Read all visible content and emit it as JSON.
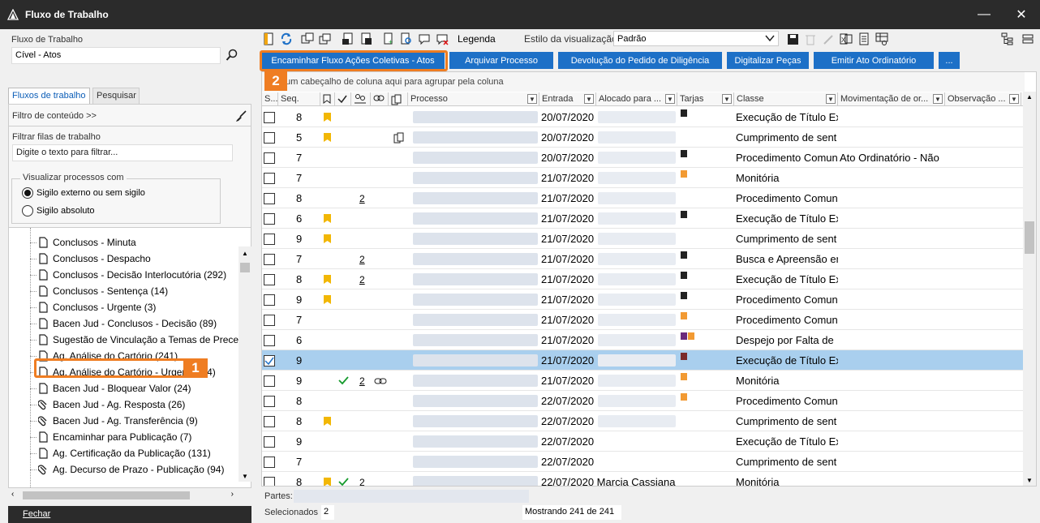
{
  "window": {
    "title": "Fluxo de Trabalho",
    "minimize": "—",
    "close": "✕"
  },
  "left": {
    "workflow_label": "Fluxo de Trabalho",
    "workflow_value": "Cível - Atos",
    "tabs": [
      "Fluxos de trabalho",
      "Pesquisar"
    ],
    "content_filter": "Filtro de conteúdo >>",
    "filter_label": "Filtrar filas de trabalho",
    "filter_placeholder": "Digite o texto para filtrar...",
    "visualize_label": "Visualizar processos com",
    "radio_options": [
      "Sigilo externo ou sem sigilo",
      "Sigilo absoluto"
    ],
    "tree_items": [
      "Conclusos - Minuta",
      "Conclusos - Despacho",
      "Conclusos - Decisão Interlocutória (292)",
      "Conclusos - Sentença (14)",
      "Conclusos - Urgente (3)",
      "Bacen Jud - Conclusos - Decisão (89)",
      "Sugestão de Vinculação a Temas de Preced",
      "Ag. Análise do Cartório (241)",
      "Ag. Análise do Cartório - Urgente (64)",
      "Bacen Jud - Bloquear Valor (24)",
      "Bacen Jud - Ag. Resposta (26)",
      "Bacen Jud - Ag. Transferência (9)",
      "Encaminhar para Publicação (7)",
      "Ag. Certificação da Publicação (131)",
      "Ag. Decurso de Prazo - Publicação (94)"
    ],
    "close_button": "Fechar",
    "callout1": "1"
  },
  "toolbar": {
    "legend": "Legenda",
    "view_style_label": "Estilo da visualização",
    "view_style_value": "Padrão",
    "actions": [
      "Encaminhar Fluxo Ações Coletivas - Atos",
      "Arquivar Processo",
      "Devolução do Pedido de Diligência",
      "Digitalizar Peças",
      "Emitir Ato Ordinatório",
      "..."
    ],
    "callout2": "2",
    "accent": "#1d70c7",
    "callout_color": "#ef7d22"
  },
  "grid": {
    "group_hint": "e um cabeçalho de coluna aqui para agrupar pela coluna",
    "columns": [
      "S...",
      "Seq.",
      "",
      "",
      "",
      "",
      "",
      "Processo",
      "Entrada",
      "Alocado para ...",
      "Tarjas",
      "Classe",
      "Movimentação de or...",
      "Observação ..."
    ],
    "rows": [
      {
        "seq": "8",
        "flag": true,
        "check": false,
        "count": "",
        "link": false,
        "doc": false,
        "entrada": "20/07/2020",
        "tarjas": [
          "#222"
        ],
        "classe": "Execução de Título Ex",
        "mov": "",
        "checked": false
      },
      {
        "seq": "5",
        "flag": true,
        "check": false,
        "count": "",
        "link": false,
        "doc": true,
        "entrada": "20/07/2020",
        "tarjas": [],
        "classe": "Cumprimento de sent",
        "mov": "",
        "checked": false
      },
      {
        "seq": "7",
        "flag": false,
        "check": false,
        "count": "",
        "link": false,
        "doc": false,
        "entrada": "20/07/2020",
        "tarjas": [
          "#222"
        ],
        "classe": "Procedimento Comun",
        "mov": "Ato Ordinatório - Não",
        "checked": false
      },
      {
        "seq": "7",
        "flag": false,
        "check": false,
        "count": "",
        "link": false,
        "doc": false,
        "entrada": "21/07/2020",
        "tarjas": [
          "#f29a33"
        ],
        "classe": "Monitória",
        "mov": "",
        "checked": false
      },
      {
        "seq": "8",
        "flag": false,
        "check": false,
        "count": "2",
        "link": false,
        "doc": false,
        "entrada": "21/07/2020",
        "tarjas": [],
        "classe": "Procedimento Comun",
        "mov": "",
        "checked": false
      },
      {
        "seq": "6",
        "flag": true,
        "check": false,
        "count": "",
        "link": false,
        "doc": false,
        "entrada": "21/07/2020",
        "tarjas": [
          "#222"
        ],
        "classe": "Execução de Título Ex",
        "mov": "",
        "checked": false
      },
      {
        "seq": "9",
        "flag": true,
        "check": false,
        "count": "",
        "link": false,
        "doc": false,
        "entrada": "21/07/2020",
        "tarjas": [],
        "classe": "Cumprimento de sent",
        "mov": "",
        "checked": false
      },
      {
        "seq": "7",
        "flag": false,
        "check": false,
        "count": "2",
        "link": false,
        "doc": false,
        "entrada": "21/07/2020",
        "tarjas": [
          "#222"
        ],
        "classe": "Busca e Apreensão er",
        "mov": "",
        "checked": false
      },
      {
        "seq": "8",
        "flag": true,
        "check": false,
        "count": "2",
        "link": false,
        "doc": false,
        "entrada": "21/07/2020",
        "tarjas": [
          "#222"
        ],
        "classe": "Execução de Título Ex",
        "mov": "",
        "checked": false
      },
      {
        "seq": "9",
        "flag": true,
        "check": false,
        "count": "",
        "link": false,
        "doc": false,
        "entrada": "21/07/2020",
        "tarjas": [
          "#222"
        ],
        "classe": "Procedimento Comun",
        "mov": "",
        "checked": false
      },
      {
        "seq": "7",
        "flag": false,
        "check": false,
        "count": "",
        "link": false,
        "doc": false,
        "entrada": "21/07/2020",
        "tarjas": [
          "#f29a33"
        ],
        "classe": "Procedimento Comun",
        "mov": "",
        "checked": false
      },
      {
        "seq": "6",
        "flag": false,
        "check": false,
        "count": "",
        "link": false,
        "doc": false,
        "entrada": "21/07/2020",
        "tarjas": [
          "#6b2a7c",
          "#f29a33"
        ],
        "classe": "Despejo por Falta de",
        "mov": "",
        "checked": false
      },
      {
        "seq": "9",
        "flag": false,
        "check": false,
        "count": "",
        "link": false,
        "doc": false,
        "entrada": "21/07/2020",
        "tarjas": [
          "#7a2a2a"
        ],
        "classe": "Execução de Título Ex",
        "mov": "",
        "checked": true
      },
      {
        "seq": "9",
        "flag": false,
        "check": true,
        "count": "2",
        "link": true,
        "doc": false,
        "entrada": "21/07/2020",
        "tarjas": [
          "#f29a33"
        ],
        "classe": "Monitória",
        "mov": "",
        "checked": false
      },
      {
        "seq": "8",
        "flag": false,
        "check": false,
        "count": "",
        "link": false,
        "doc": false,
        "entrada": "22/07/2020",
        "tarjas": [
          "#f29a33"
        ],
        "classe": "Procedimento Comun",
        "mov": "",
        "checked": false
      },
      {
        "seq": "8",
        "flag": true,
        "check": false,
        "count": "",
        "link": false,
        "doc": false,
        "entrada": "22/07/2020",
        "tarjas": [],
        "classe": "Cumprimento de sent",
        "mov": "",
        "checked": false
      },
      {
        "seq": "9",
        "flag": false,
        "check": false,
        "count": "",
        "link": false,
        "doc": false,
        "entrada": "22/07/2020",
        "tarjas": [],
        "classe": "Execução de Título Ex",
        "mov": "",
        "checked": false
      },
      {
        "seq": "7",
        "flag": false,
        "check": false,
        "count": "",
        "link": false,
        "doc": false,
        "entrada": "22/07/2020",
        "tarjas": [],
        "classe": "Cumprimento de sent",
        "mov": "",
        "checked": false
      },
      {
        "seq": "8",
        "flag": true,
        "check": true,
        "count": "2",
        "link": false,
        "doc": false,
        "entrada": "22/07/2020 Marcia Cassiana",
        "tarjas": [],
        "classe": "Monitória",
        "mov": "",
        "checked": false
      }
    ]
  },
  "status": {
    "partes": "Partes:",
    "selecionados_label": "Selecionados",
    "selecionados_value": "2",
    "showing": "Mostrando 241 de 241"
  }
}
